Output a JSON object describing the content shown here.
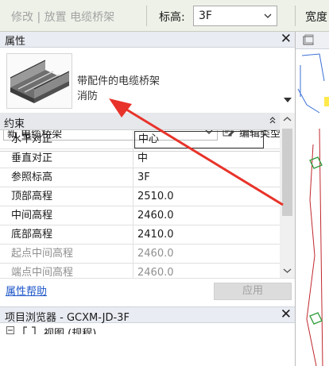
{
  "optionbar": {
    "context_label": "修改 | 放置 电缆桥架",
    "level_label": "标高:",
    "level_value": "3F",
    "width_label": "宽度"
  },
  "properties": {
    "title": "属性",
    "type_line1": "带配件的电缆桥架",
    "type_line2": "消防",
    "instance_selector": "新 电缆桥架",
    "edit_type_label": "编辑类型",
    "category": "约束",
    "rows": [
      {
        "name": "水平对正",
        "value": "中心"
      },
      {
        "name": "垂直对正",
        "value": "中"
      },
      {
        "name": "参照标高",
        "value": "3F"
      },
      {
        "name": "顶部高程",
        "value": "2510.0"
      },
      {
        "name": "中间高程",
        "value": "2460.0"
      },
      {
        "name": "底部高程",
        "value": "2410.0"
      },
      {
        "name": "起点中间高程",
        "value": "2460.0"
      },
      {
        "name": "端点中间高程",
        "value": "2460.0"
      }
    ],
    "help_link": "属性帮助",
    "apply_label": "应用"
  },
  "project_browser": {
    "title": "项目浏览器 - GCXM-JD-3F",
    "first_item": "视图 (规程)"
  },
  "colors": {
    "annotation_arrow": "#e8332a",
    "link": "#1c55c8",
    "panel_header": "#e9ecf2"
  }
}
